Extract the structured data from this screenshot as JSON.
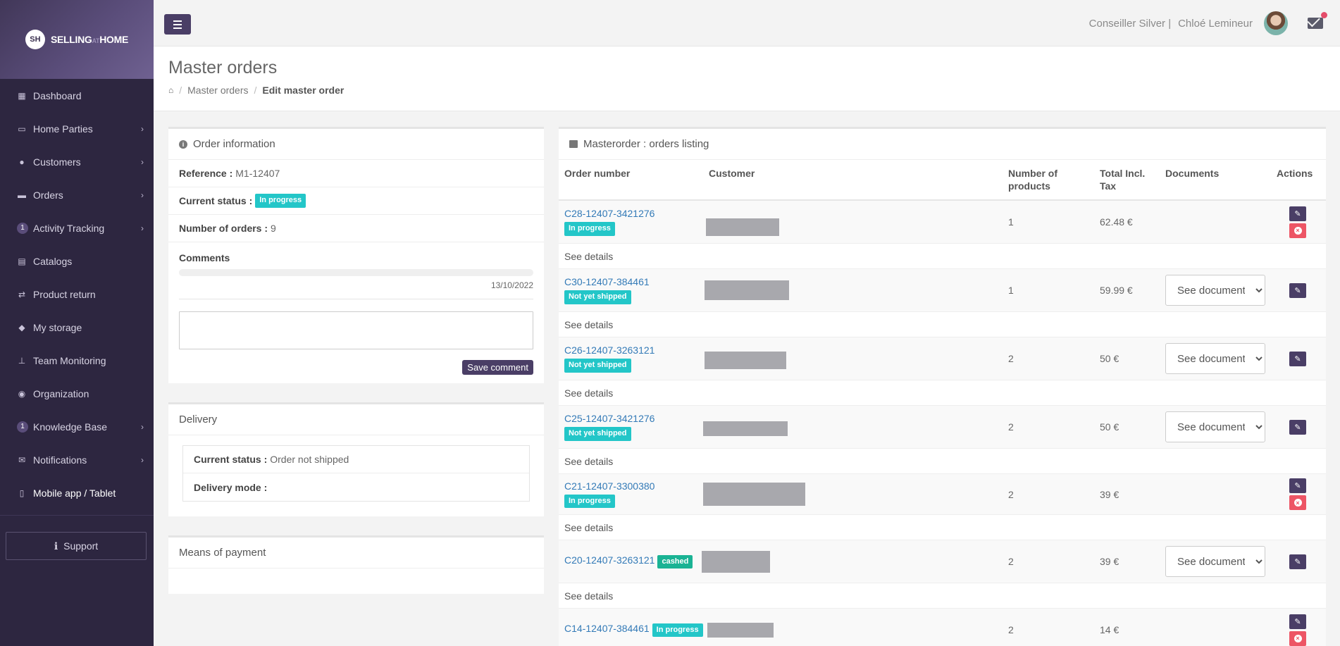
{
  "brand": {
    "logo": "SH",
    "name_part1": "SELLING",
    "name_part2": "AT",
    "name_part3": "HOME"
  },
  "sidebar": {
    "items": [
      {
        "label": "Dashboard",
        "icon": "dashboard-icon"
      },
      {
        "label": "Home Parties",
        "icon": "calendar-icon"
      },
      {
        "label": "Customers",
        "icon": "users-icon"
      },
      {
        "label": "Orders",
        "icon": "credit-card-icon"
      },
      {
        "label": "Activity Tracking",
        "count": "1"
      },
      {
        "label": "Catalogs",
        "icon": "archive-icon"
      },
      {
        "label": "Product return",
        "icon": "exchange-icon"
      },
      {
        "label": "My storage",
        "icon": "cube-icon"
      },
      {
        "label": "Team Monitoring",
        "icon": "sitemap-icon"
      },
      {
        "label": "Organization",
        "icon": "globe-icon"
      },
      {
        "label": "Knowledge Base",
        "count": "1"
      },
      {
        "label": "Notifications",
        "icon": "envelope-icon"
      },
      {
        "label": "Mobile app / Tablet",
        "icon": "mobile-icon"
      }
    ],
    "support_label": "Support"
  },
  "topbar": {
    "role": "Conseiller Silver |",
    "user_name": "Chloé Lemineur"
  },
  "page": {
    "title": "Master orders",
    "breadcrumb": [
      "Master orders",
      "Edit master order"
    ]
  },
  "order_info": {
    "title": "Order information",
    "reference_label": "Reference :",
    "reference_value": "M1-12407",
    "status_label": "Current status :",
    "status_value": "In progress",
    "count_label": "Number of orders :",
    "count_value": "9",
    "comments_label": "Comments",
    "comment_date": "13/10/2022",
    "save_label": "Save comment"
  },
  "delivery": {
    "title": "Delivery",
    "status_label": "Current status :",
    "status_value": "Order not shipped",
    "mode_label": "Delivery mode :"
  },
  "payment": {
    "title": "Means of payment"
  },
  "orders": {
    "title": "Masterorder : orders listing",
    "columns": [
      "Order number",
      "Customer",
      "Number of products",
      "Total Incl. Tax",
      "Documents",
      "Actions"
    ],
    "details_label": "See details",
    "select_label": "See documents",
    "rows": [
      {
        "number": "C28-12407-3421276",
        "status": "In progress",
        "products": "1",
        "total": "62.48 €"
      },
      {
        "number": "C30-12407-384461",
        "status": "Not yet shipped",
        "products": "1",
        "total": "59.99 €"
      },
      {
        "number": "C26-12407-3263121",
        "status": "Not yet shipped",
        "products": "2",
        "total": "50 €"
      },
      {
        "number": "C25-12407-3421276",
        "status": "Not yet shipped",
        "products": "2",
        "total": "50 €"
      },
      {
        "number": "C21-12407-3300380",
        "status": "In progress",
        "products": "2",
        "total": "39 €"
      },
      {
        "number": "C20-12407-3263121",
        "status": "cashed",
        "products": "2",
        "total": "39 €"
      },
      {
        "number": "C14-12407-384461",
        "status": "In progress",
        "products": "2",
        "total": "14 €"
      }
    ]
  },
  "colors": {
    "sidebar": "#2d2640",
    "primary": "#4a3e66",
    "badge_info": "#23c6c8",
    "badge_success": "#1ab394",
    "danger": "#ed5565",
    "link": "#337ab7"
  }
}
